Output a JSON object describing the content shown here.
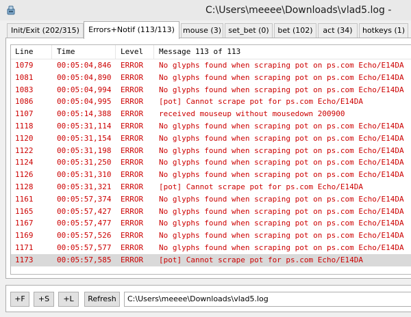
{
  "window": {
    "title": "C:\\Users\\meeee\\Downloads\\vlad5.log -",
    "icon": "app-icon"
  },
  "tabs": [
    {
      "label": "Init/Exit (202/315)",
      "active": false
    },
    {
      "label": "Errors+Notif (113/113)",
      "active": true
    },
    {
      "label": "mouse (3)",
      "active": false
    },
    {
      "label": "set_bet (0)",
      "active": false
    },
    {
      "label": "bet (102)",
      "active": false
    },
    {
      "label": "act (34)",
      "active": false
    },
    {
      "label": "hotkeys (1)",
      "active": false
    }
  ],
  "table": {
    "headers": {
      "line": "Line",
      "time": "Time",
      "level": "Level",
      "message": "Message 113 of 113"
    },
    "rows": [
      {
        "line": "1079",
        "time": "00:05:04,846",
        "level": "ERROR",
        "message": "No glyphs found when scraping pot on ps.com Echo/E14DA"
      },
      {
        "line": "1081",
        "time": "00:05:04,890",
        "level": "ERROR",
        "message": "No glyphs found when scraping pot on ps.com Echo/E14DA"
      },
      {
        "line": "1083",
        "time": "00:05:04,994",
        "level": "ERROR",
        "message": "No glyphs found when scraping pot on ps.com Echo/E14DA"
      },
      {
        "line": "1086",
        "time": "00:05:04,995",
        "level": "ERROR",
        "message": "[pot] Cannot scrape pot for ps.com Echo/E14DA"
      },
      {
        "line": "1107",
        "time": "00:05:14,388",
        "level": "ERROR",
        "message": "received mouseup without mousedown 200900"
      },
      {
        "line": "1118",
        "time": "00:05:31,114",
        "level": "ERROR",
        "message": "No glyphs found when scraping pot on ps.com Echo/E14DA"
      },
      {
        "line": "1120",
        "time": "00:05:31,154",
        "level": "ERROR",
        "message": "No glyphs found when scraping pot on ps.com Echo/E14DA"
      },
      {
        "line": "1122",
        "time": "00:05:31,198",
        "level": "ERROR",
        "message": "No glyphs found when scraping pot on ps.com Echo/E14DA"
      },
      {
        "line": "1124",
        "time": "00:05:31,250",
        "level": "ERROR",
        "message": "No glyphs found when scraping pot on ps.com Echo/E14DA"
      },
      {
        "line": "1126",
        "time": "00:05:31,310",
        "level": "ERROR",
        "message": "No glyphs found when scraping pot on ps.com Echo/E14DA"
      },
      {
        "line": "1128",
        "time": "00:05:31,321",
        "level": "ERROR",
        "message": "[pot] Cannot scrape pot for ps.com Echo/E14DA"
      },
      {
        "line": "1161",
        "time": "00:05:57,374",
        "level": "ERROR",
        "message": "No glyphs found when scraping pot on ps.com Echo/E14DA"
      },
      {
        "line": "1165",
        "time": "00:05:57,427",
        "level": "ERROR",
        "message": "No glyphs found when scraping pot on ps.com Echo/E14DA"
      },
      {
        "line": "1167",
        "time": "00:05:57,477",
        "level": "ERROR",
        "message": "No glyphs found when scraping pot on ps.com Echo/E14DA"
      },
      {
        "line": "1169",
        "time": "00:05:57,526",
        "level": "ERROR",
        "message": "No glyphs found when scraping pot on ps.com Echo/E14DA"
      },
      {
        "line": "1171",
        "time": "00:05:57,577",
        "level": "ERROR",
        "message": "No glyphs found when scraping pot on ps.com Echo/E14DA"
      },
      {
        "line": "1173",
        "time": "00:05:57,585",
        "level": "ERROR",
        "message": "[pot] Cannot scrape pot for ps.com Echo/E14DA",
        "selected": true
      }
    ]
  },
  "footer": {
    "buttons": [
      "+F",
      "+S",
      "+L",
      "Refresh"
    ],
    "path": "C:\\Users\\meeee\\Downloads\\vlad5.log"
  },
  "colors": {
    "error_text": "#cc0000",
    "selected_row": "#d9d9d9"
  }
}
